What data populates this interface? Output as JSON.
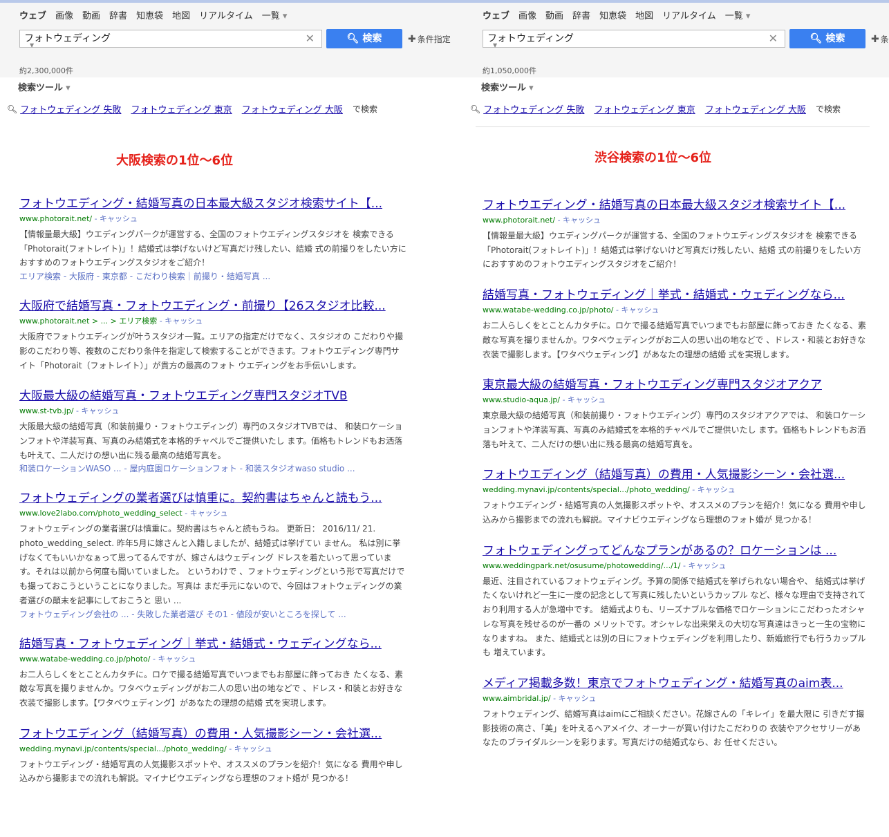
{
  "tabs": [
    "ウェブ",
    "画像",
    "動画",
    "辞書",
    "知恵袋",
    "地図",
    "リアルタイム",
    "一覧"
  ],
  "search": {
    "query": "フォトウェディング",
    "button_label": "検索",
    "condition_label": "条件指定"
  },
  "tools_label": "検索ツール",
  "related": {
    "items": [
      "フォトウェディング 失敗",
      "フォトウェディング 東京",
      "フォトウェディング 大阪"
    ],
    "suffix": "で検索"
  },
  "left": {
    "result_count": "約2,300,000件",
    "label": "大阪検索の1位～6位",
    "results": [
      {
        "title": "フォトウエディング・結婚写真の日本最大級スタジオ検索サイト【...",
        "url": "www.photorait.net/",
        "cache": " - キャッシュ",
        "desc": "【情報量最大級】ウエディングパークが運営する、全国のフォトウエディングスタジオを 検索できる「Photorait(フォトレイト)」！結婚式は挙げないけど写真だけ残したい、結婚 式の前撮りをしたい方におすすめのフォトウエディングスタジオをご紹介！",
        "links": "エリア検索 - 大阪府 - 東京都 - こだわり検索｜前撮り・結婚写真 ..."
      },
      {
        "title": "大阪府で結婚写真・フォトウエディング・前撮り【26スタジオ比較...",
        "url": "www.photorait.net > ... > エリア検索",
        "cache": " - キャッシュ",
        "desc": "大阪府でフォトウエディングが叶うスタジオ一覧。エリアの指定だけでなく、スタジオの こだわりや撮影のこだわり等、複数のこだわり条件を指定して検索することができます。フォトウエディング専門サイト「Photorait（フォトレイト）」が貴方の最高のフォト ウエディングをお手伝いします。",
        "links": ""
      },
      {
        "title": "大阪最大級の結婚写真・フォトウエディング専門スタジオTVB",
        "url": "www.st-tvb.jp/",
        "cache": " - キャッシュ",
        "desc": "大阪最大級の結婚写真（和装前撮り・フォトウエディング）専門のスタジオTVBでは、 和装ロケーションフォトや洋装写真、写真のみ結婚式を本格的チャペルでご提供いたし ます。価格もトレンドもお洒落も叶えて、二人だけの想い出に残る最高の結婚写真を。",
        "links": "和装ロケーションWASO ... - 屋内庭園ロケーションフォト - 和装スタジオwaso studio ..."
      },
      {
        "title": "フォトウェディングの業者選びは慎重に。契約書はちゃんと読もう...",
        "url": "www.love2labo.com/photo_wedding_select",
        "cache": " - キャッシュ",
        "desc": "フォトウェディングの業者選びは慎重に。契約書はちゃんと読もうね。 更新日： 2016/11/ 21. photo_wedding_select. 昨年5月に嫁さんと入籍しましたが、結婚式は挙げてい ません。 私は別に挙げなくてもいいかなぁって思ってるんですが、嫁さんはウェディング ドレスを着たいって思っています。それは以前から何度も聞いていました。 というわけで 、フォトウェディングという形で写真だけでも撮っておこうということになりました。写真は まだ手元にないので、今回はフォトウェディングの業者選びの顛末を記事にしておこうと 思い ...",
        "links": "フォトウェディング会社の ... - 失敗した業者選び その1 - 値段が安いところを探して ..."
      },
      {
        "title": "結婚写真・フォトウェディング｜挙式・結婚式・ウェディングなら...",
        "url": "www.watabe-wedding.co.jp/photo/",
        "cache": " - キャッシュ",
        "desc": "お二人らしくをとことんカタチに。ロケで撮る結婚写真でいつまでもお部屋に飾っておき たくなる、素敵な写真を撮りませんか。ワタベウェディングがお二人の思い出の地などで 、ドレス・和装とお好きな衣装で撮影します。【ワタベウェディング】があなたの理想の結婚 式を実現します。",
        "links": ""
      },
      {
        "title": "フォトウエディング（結婚写真）の費用・人気撮影シーン・会社選...",
        "url": "wedding.mynavi.jp/contents/special.../photo_wedding/",
        "cache": " - キャッシュ",
        "desc": "フォトウエディング・結婚写真の人気撮影スポットや、オススメのプランを紹介！気になる 費用や申し込みから撮影までの流れも解説。マイナビウエディングなら理想のフォト婚が 見つかる！",
        "links": ""
      }
    ]
  },
  "right": {
    "result_count": "約1,050,000件",
    "label": "渋谷検索の1位～6位",
    "results": [
      {
        "title": "フォトウエディング・結婚写真の日本最大級スタジオ検索サイト【...",
        "url": "www.photorait.net/",
        "cache": " - キャッシュ",
        "desc": "【情報量最大級】ウエディングパークが運営する、全国のフォトウエディングスタジオを 検索できる「Photorait(フォトレイト)」！結婚式は挙げないけど写真だけ残したい、結婚 式の前撮りをしたい方におすすめのフォトウエディングスタジオをご紹介！",
        "links": ""
      },
      {
        "title": "結婚写真・フォトウェディング｜挙式・結婚式・ウェディングなら...",
        "url": "www.watabe-wedding.co.jp/photo/",
        "cache": " - キャッシュ",
        "desc": "お二人らしくをとことんカタチに。ロケで撮る結婚写真でいつまでもお部屋に飾っておき たくなる、素敵な写真を撮りませんか。ワタベウェディングがお二人の思い出の地などで 、ドレス・和装とお好きな衣装で撮影します。【ワタベウェディング】があなたの理想の結婚 式を実現します。",
        "links": ""
      },
      {
        "title": "東京最大級の結婚写真・フォトウエディング専門スタジオアクア",
        "url": "www.studio-aqua.jp/",
        "cache": " - キャッシュ",
        "desc": "東京最大級の結婚写真（和装前撮り・フォトウエディング）専門のスタジオアクアでは、 和装ロケーションフォトや洋装写真、写真のみ結婚式を本格的チャペルでご提供いたし ます。価格もトレンドもお洒落も叶えて、二人だけの想い出に残る最高の結婚写真を。",
        "links": ""
      },
      {
        "title": "フォトウエディング（結婚写真）の費用・人気撮影シーン・会社選...",
        "url": "wedding.mynavi.jp/contents/special.../photo_wedding/",
        "cache": " - キャッシュ",
        "desc": "フォトウエディング・結婚写真の人気撮影スポットや、オススメのプランを紹介！気になる 費用や申し込みから撮影までの流れも解説。マイナビウエディングなら理想のフォト婚が 見つかる！",
        "links": ""
      },
      {
        "title": "フォトウェディングってどんなプランがあるの？ロケーションは ...",
        "url": "www.weddingpark.net/osusume/photowedding/.../1/",
        "cache": " - キャッシュ",
        "desc": "最近、注目されているフォトウェディング。予算の関係で結婚式を挙げられない場合や、 結婚式は挙げたくないけれど一生に一度の記念として写真に残したいというカップル など、様々な理由で支持されており利用する人が急増中です。 結婚式よりも、リーズナブルな価格でロケーションにこだわったオシャレな写真を残せるのが一番の メリットです。オシャレな出来栄えの大切な写真達はきっと一生の宝物になりますね。 また、結婚式とは別の日にフォトウェディングを利用したり、新婚旅行でも行うカップルも 増えています。",
        "links": ""
      },
      {
        "title": "メディア掲載多数！東京でフォトウェディング・結婚写真のaim表...",
        "url": "www.aimbridal.jp/",
        "cache": " - キャッシュ",
        "desc": "フォトウェディング、結婚写真はaimにご相談ください。花嫁さんの「キレイ」を最大限に 引きだす撮影技術の高さ、「美」を叶えるヘアメイク、オーナーが買い付けたこだわりの 衣装やアクセサリーがあなたのブライダルシーンを彩ります。写真だけの結婚式なら、お 任せください。",
        "links": ""
      }
    ]
  }
}
